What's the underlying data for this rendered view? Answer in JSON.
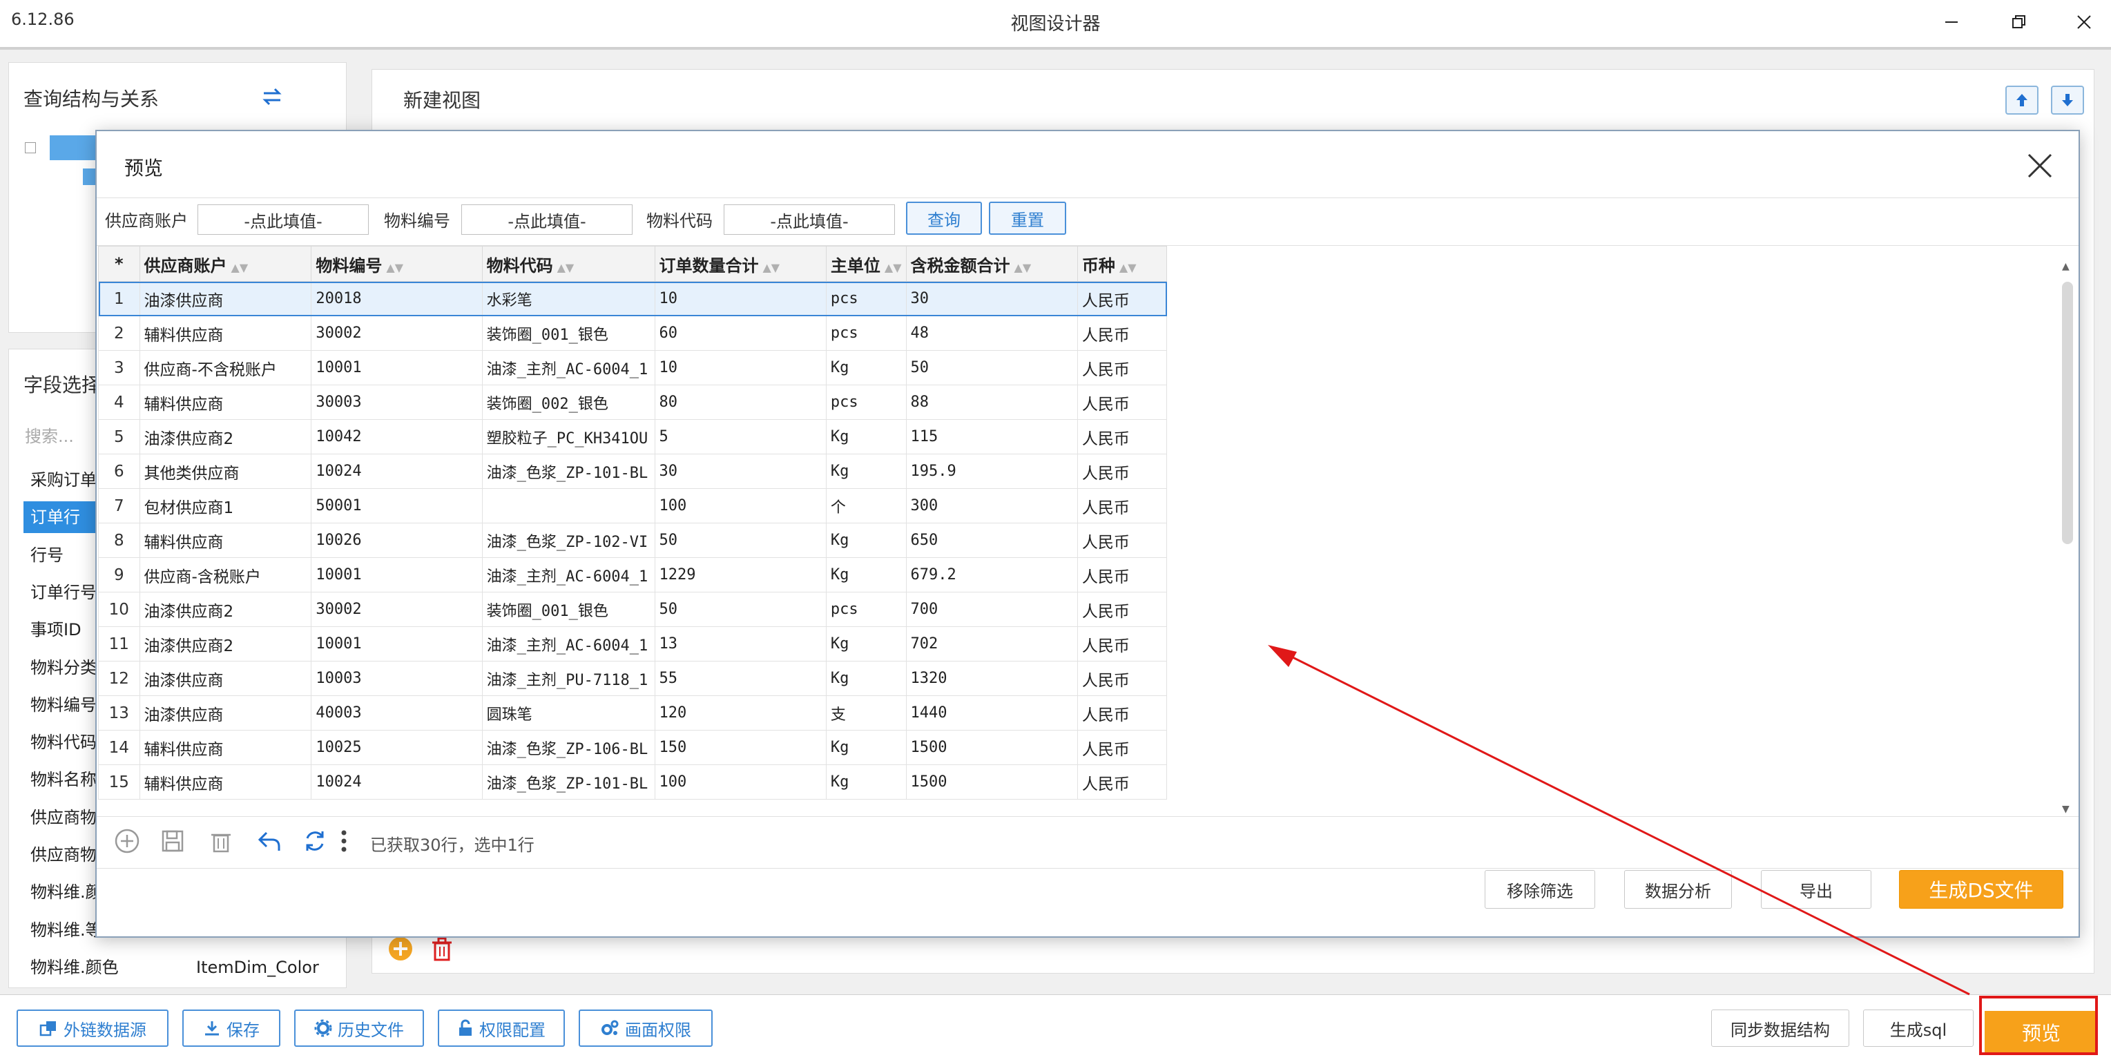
{
  "titlebar": {
    "version": "6.12.86",
    "title": "视图设计器"
  },
  "left": {
    "query_title": "查询结构与关系",
    "field_title": "字段选择",
    "search_placeholder": "搜索...",
    "fields": [
      {
        "label": "采购订单",
        "value": "",
        "selected": false
      },
      {
        "label": "订单行状",
        "value": "",
        "selected": true
      },
      {
        "label": "行号",
        "value": "",
        "selected": false
      },
      {
        "label": "订单行号",
        "value": "",
        "selected": false
      },
      {
        "label": "事项ID",
        "value": "",
        "selected": false
      },
      {
        "label": "物料分类",
        "value": "",
        "selected": false
      },
      {
        "label": "物料编号",
        "value": "",
        "selected": false
      },
      {
        "label": "物料代码",
        "value": "",
        "selected": false
      },
      {
        "label": "物料名称",
        "value": "",
        "selected": false
      },
      {
        "label": "供应商物",
        "value": "",
        "selected": false
      },
      {
        "label": "供应商物",
        "value": "",
        "selected": false
      },
      {
        "label": "物料维.颜",
        "value": "",
        "selected": false
      },
      {
        "label": "物料维.等",
        "value": "",
        "selected": false
      },
      {
        "label": "物料维.颜色",
        "value": "ItemDim_Color",
        "selected": false
      }
    ]
  },
  "main": {
    "title": "新建视图"
  },
  "dialog": {
    "title": "预览",
    "filters": [
      {
        "label": "供应商账户",
        "placeholder": "-点此填值-"
      },
      {
        "label": "物料编号",
        "placeholder": "-点此填值-"
      },
      {
        "label": "物料代码",
        "placeholder": "-点此填值-"
      }
    ],
    "query_btn": "查询",
    "reset_btn": "重置",
    "columns": [
      "*",
      "供应商账户",
      "物料编号",
      "物料代码",
      "订单数量合计",
      "主单位",
      "含税金额合计",
      "币种"
    ],
    "rows": [
      [
        "1",
        "油漆供应商",
        "20018",
        "水彩笔",
        "10",
        "pcs",
        "30",
        "人民币"
      ],
      [
        "2",
        "辅料供应商",
        "30002",
        "装饰圈_001_银色",
        "60",
        "pcs",
        "48",
        "人民币"
      ],
      [
        "3",
        "供应商-不含税账户",
        "10001",
        "油漆_主剂_AC-6004_1",
        "10",
        "Kg",
        "50",
        "人民币"
      ],
      [
        "4",
        "辅料供应商",
        "30003",
        "装饰圈_002_银色",
        "80",
        "pcs",
        "88",
        "人民币"
      ],
      [
        "5",
        "油漆供应商2",
        "10042",
        "塑胶粒子_PC_KH341OU",
        "5",
        "Kg",
        "115",
        "人民币"
      ],
      [
        "6",
        "其他类供应商",
        "10024",
        "油漆_色浆_ZP-101-BL",
        "30",
        "Kg",
        "195.9",
        "人民币"
      ],
      [
        "7",
        "包材供应商1",
        "50001",
        "",
        "100",
        "个",
        "300",
        "人民币"
      ],
      [
        "8",
        "辅料供应商",
        "10026",
        "油漆_色浆_ZP-102-VI",
        "50",
        "Kg",
        "650",
        "人民币"
      ],
      [
        "9",
        "供应商-含税账户",
        "10001",
        "油漆_主剂_AC-6004_1",
        "1229",
        "Kg",
        "679.2",
        "人民币"
      ],
      [
        "10",
        "油漆供应商2",
        "30002",
        "装饰圈_001_银色",
        "50",
        "pcs",
        "700",
        "人民币"
      ],
      [
        "11",
        "油漆供应商2",
        "10001",
        "油漆_主剂_AC-6004_1",
        "13",
        "Kg",
        "702",
        "人民币"
      ],
      [
        "12",
        "油漆供应商",
        "10003",
        "油漆_主剂_PU-7118_1",
        "55",
        "Kg",
        "1320",
        "人民币"
      ],
      [
        "13",
        "油漆供应商",
        "40003",
        "圆珠笔",
        "120",
        "支",
        "1440",
        "人民币"
      ],
      [
        "14",
        "辅料供应商",
        "10025",
        "油漆_色浆_ZP-106-BL",
        "150",
        "Kg",
        "1500",
        "人民币"
      ],
      [
        "15",
        "辅料供应商",
        "10024",
        "油漆_色浆_ZP-101-BL",
        "100",
        "Kg",
        "1500",
        "人民币"
      ]
    ],
    "selected_row": 0,
    "status": "已获取30行，选中1行",
    "actions": {
      "remove_filter": "移除筛选",
      "analyze": "数据分析",
      "export": "导出",
      "gen_ds": "生成DS文件"
    }
  },
  "bottom": {
    "ext_source": "外链数据源",
    "save": "保存",
    "history": "历史文件",
    "perm_config": "权限配置",
    "screen_perm": "画面权限",
    "sync": "同步数据结构",
    "gen_sql": "生成sql",
    "preview": "预览"
  },
  "colors": {
    "accent": "#2f8ee0",
    "orange": "#f7a11a",
    "highlight": "#e01818"
  }
}
